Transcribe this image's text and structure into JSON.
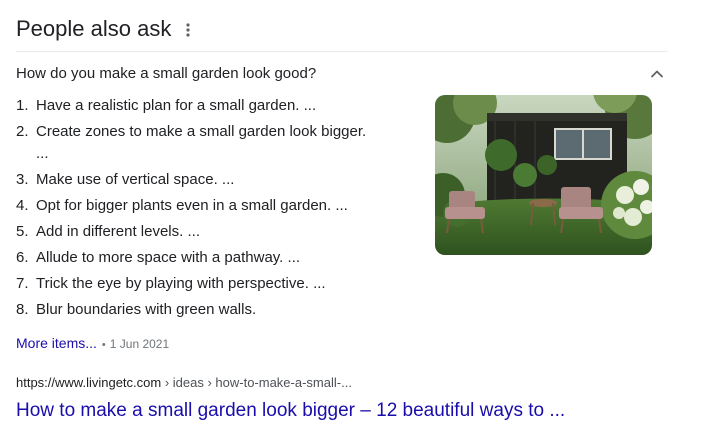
{
  "header": {
    "title": "People also ask",
    "menu_icon": "more-vert-icon"
  },
  "question": {
    "text": "How do you make a small garden look good?",
    "expanded_icon": "chevron-up-icon"
  },
  "answer": {
    "items": [
      {
        "num": "1.",
        "text": "Have a realistic plan for a small garden. ..."
      },
      {
        "num": "2.",
        "text": "Create zones to make a small garden look bigger.",
        "continuation": "..."
      },
      {
        "num": "3.",
        "text": "Make use of vertical space. ..."
      },
      {
        "num": "4.",
        "text": "Opt for bigger plants even in a small garden. ..."
      },
      {
        "num": "5.",
        "text": "Add in different levels. ..."
      },
      {
        "num": "6.",
        "text": "Allude to more space with a pathway. ..."
      },
      {
        "num": "7.",
        "text": "Trick the eye by playing with perspective. ..."
      },
      {
        "num": "8.",
        "text": "Blur boundaries with green walls."
      }
    ],
    "more_items": "More items...",
    "bullet": "•",
    "date": "1 Jun 2021"
  },
  "source": {
    "url": "https://www.livingetc.com",
    "breadcrumb": " › ideas › how-to-make-a-small-...",
    "title": "How to make a small garden look bigger – 12 beautiful ways to ..."
  },
  "colors": {
    "link": "#1a0dab",
    "text": "#202124",
    "muted": "#70757a",
    "divider": "#e8eaed"
  }
}
